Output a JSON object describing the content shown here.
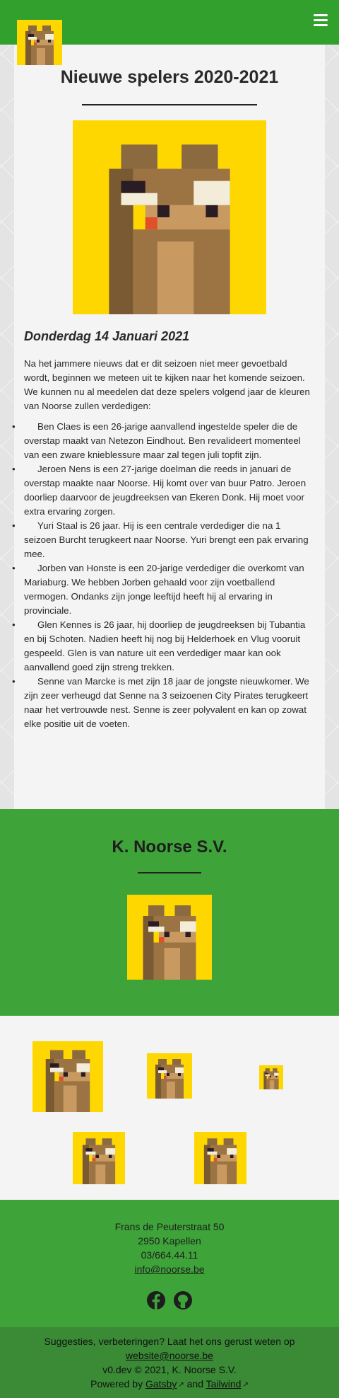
{
  "header": {
    "menu_icon": "hamburger-menu-icon",
    "logo_icon": "squirrel-logo-icon",
    "bar_color": "#31a02c"
  },
  "article": {
    "title": "Nieuwe spelers 2020-2021",
    "date": "Donderdag 14 Januari 2021",
    "intro": "Na het jammere nieuws dat er dit seizoen niet meer gevoetbald wordt, beginnen we meteen uit te kijken naar het komende seizoen. We kunnen nu al meedelen dat deze spelers volgend jaar de kleuren van Noorse zullen verdedigen:",
    "players": [
      "Ben Claes is een 26-jarige aanvallend ingestelde speler die de overstap maakt van Netezon Eindhout. Ben revalideert momenteel van een zware knieblessure maar zal tegen juli topfit zijn.",
      "Jeroen Nens is een 27-jarige doelman die reeds in januari de overstap maakte naar Noorse. Hij komt over van buur Patro. Jeroen doorliep daarvoor de jeugdreeksen van Ekeren Donk. Hij moet voor extra ervaring zorgen.",
      "Yuri Staal is 26 jaar. Hij is een centrale verdediger die na 1 seizoen Burcht terugkeert naar Noorse. Yuri brengt een pak ervaring mee.",
      "Jorben van Honste is een 20-jarige verdediger die overkomt van Mariaburg. We hebben Jorben gehaald voor zijn voetballend vermogen. Ondanks zijn jonge leeftijd heeft hij al ervaring in provinciale.",
      "Glen Kennes is 26 jaar, hij doorliep de jeugdreeksen bij Tubantia en bij Schoten. Nadien heeft hij nog bij Helderhoek en Vlug vooruit gespeeld. Glen is van nature uit een verdediger maar kan ook aanvallend goed zijn streng trekken.",
      "Senne van Marcke is met zijn 18 jaar de jongste nieuwkomer. We zijn zeer verheugd dat Senne na 3 seizoenen City Pirates terugkeert naar het vertrouwde nest. Senne is zeer polyvalent en kan op zowat elke positie uit de voeten."
    ]
  },
  "club": {
    "name": "K. Noorse S.V."
  },
  "contact": {
    "street": "Frans de Peuterstraat 50",
    "city": "2950 Kapellen",
    "phone": "03/664.44.11",
    "email": "info@noorse.be",
    "social_icons": [
      "facebook-icon",
      "github-icon"
    ]
  },
  "footer": {
    "feedback": "Suggesties, verbeteringen? Laat het ons gerust weten op",
    "feedback_email": "website@noorse.be",
    "version": "v0.dev © 2021, K. Noorse S.V.",
    "powered_by": "Powered by",
    "gatsby": "Gatsby",
    "and": "and",
    "tailwind": "Tailwind"
  },
  "colors": {
    "green": "#3ea43a",
    "dark_green": "#3a8a36",
    "logo_yellow": "#ffd700"
  }
}
